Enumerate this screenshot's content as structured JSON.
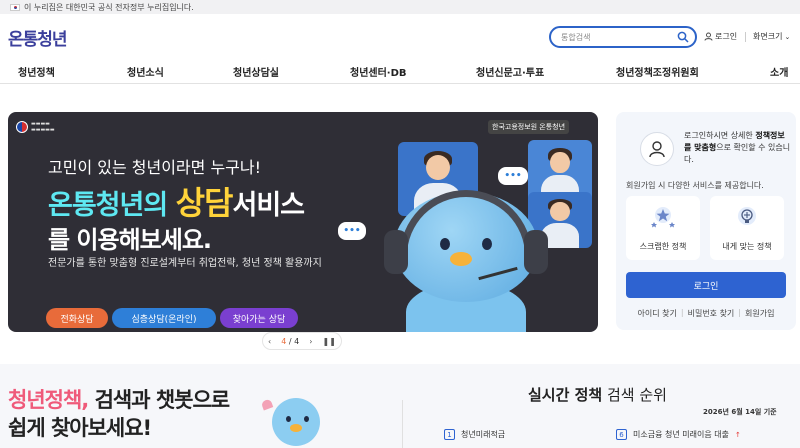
{
  "gov_banner": {
    "text": "이 누리집은 대한민국 공식 전자정부 누리집입니다."
  },
  "header": {
    "logo": "온통청년",
    "search_placeholder": "통합검색",
    "login": "로그인",
    "zoom": "화면크기"
  },
  "nav": {
    "items": [
      "청년정책",
      "청년소식",
      "청년상담실",
      "청년센터·DB",
      "청년신문고·투표",
      "청년정책조정위원회",
      "소개"
    ]
  },
  "hero": {
    "line1": "고민이 있는 청년이라면 누구나!",
    "line2_a": "온통청년의 ",
    "line2_b": "상담",
    "line2_c": "서비스",
    "line3": "를 이용해보세요.",
    "sub": "전문가를 통한 맞춤형 진로설계부터 취업전략, 청년 정책 활용까지",
    "pills": [
      "전화상담",
      "심층상담(온라인)",
      "찾아가는 상담"
    ],
    "partner": "한국고용정보원 온통청년",
    "bubble": "•••",
    "pager": {
      "current": "4",
      "total": "4"
    }
  },
  "panel": {
    "msg_pre": "로그인하시면 상세한 ",
    "msg_bold": "정책정보를 맞춤형",
    "msg_post": "으로 확인할 수 있습니다.",
    "sub": "회원가입 시 다양한 서비스를 제공합니다.",
    "services": [
      "스크랩한 정책",
      "내게 맞는 정책"
    ],
    "login_button": "로그인",
    "links": [
      "아이디 찾기",
      "비밀번호 찾기",
      "회원가입"
    ]
  },
  "bottom": {
    "title_pink": "청년정책,",
    "title_rest": " 검색과 챗봇으로",
    "title2": "쉽게 찾아보세요!",
    "realtime_bold": "실시간 정책",
    "realtime_rest": " 검색 순위",
    "date": "2026년 6월 14일 기준",
    "ranks": [
      {
        "num": "1",
        "label": "청년미래적금"
      },
      {
        "num": "6",
        "label": "미소금융 청년 미래이음 대출"
      }
    ]
  },
  "colors": {
    "brand_blue": "#2e63d1",
    "accent_orange": "#e86b3a",
    "hero_bg": "#2f2e36",
    "pink": "#ef5a7a"
  }
}
